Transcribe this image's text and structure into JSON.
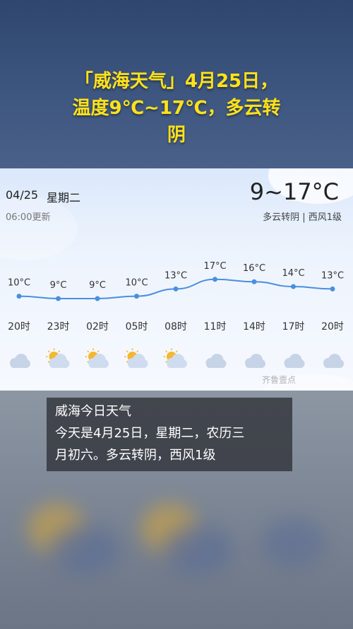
{
  "headline": {
    "line1": "「威海天气」4月25日，",
    "line2": "温度9℃~17℃，多云转",
    "line3": "阴"
  },
  "card": {
    "date": "04/25",
    "weekday": "星期二",
    "updated": "06:00更新",
    "temp_range": "9~17°C",
    "condition": "多云转阴 | 西风1级"
  },
  "chart_data": {
    "type": "line",
    "x": [
      "20时",
      "23时",
      "02时",
      "05时",
      "08时",
      "11时",
      "14时",
      "17时",
      "20时"
    ],
    "values": [
      10,
      9,
      9,
      10,
      13,
      17,
      16,
      14,
      13
    ],
    "labels": [
      "10°C",
      "9°C",
      "9°C",
      "10°C",
      "13°C",
      "17°C",
      "16°C",
      "14°C",
      "13°C"
    ],
    "icons": [
      "cloud-icon",
      "partly-cloudy-icon",
      "partly-cloudy-icon",
      "partly-cloudy-icon",
      "partly-cloudy-icon",
      "cloud-icon",
      "cloud-icon",
      "cloud-icon",
      "cloud-icon"
    ],
    "line_color": "#4a8fe0"
  },
  "caption": {
    "line1": "威海今日天气",
    "line2": "今天是4月25日，星期二，农历三",
    "line3": "月初六。多云转阴，西风1级"
  },
  "watermark": "齐鲁壹点"
}
